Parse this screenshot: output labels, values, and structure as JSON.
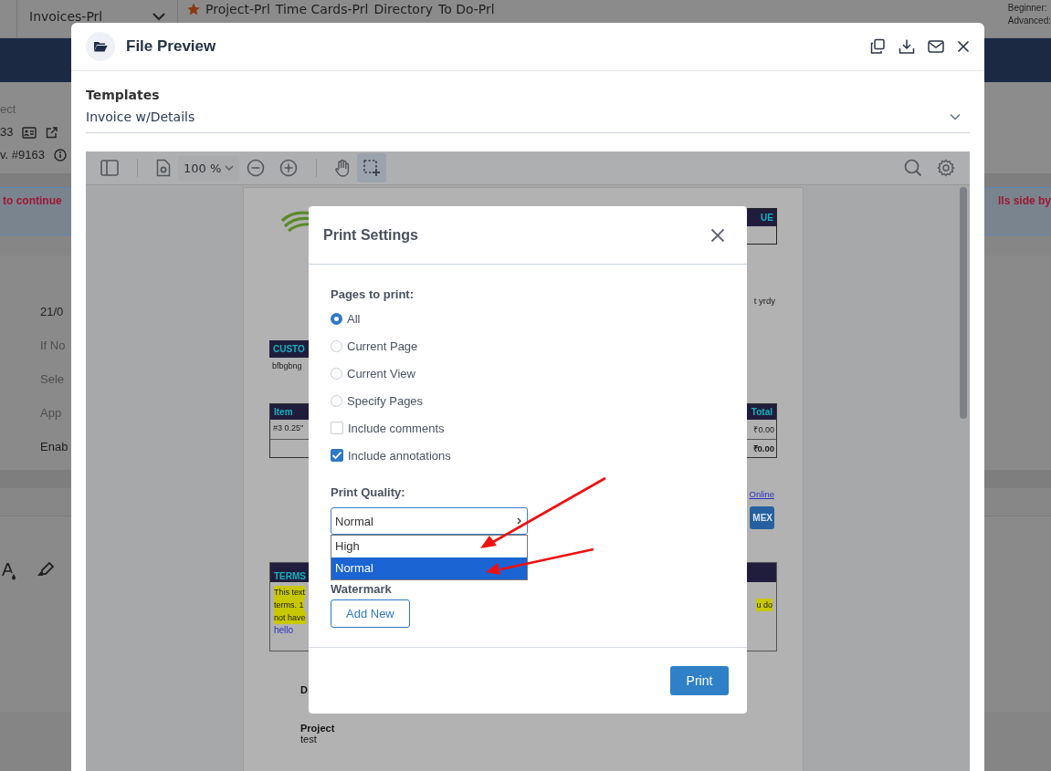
{
  "app_bar": {
    "menu_item": "Invoices-Prl",
    "favorites": [
      {
        "label": "Project-Prl",
        "starred": true
      },
      {
        "label": "Time Cards-Prl",
        "starred": false
      },
      {
        "label": "Directory",
        "starred": false
      },
      {
        "label": "To Do-Prl",
        "starred": false
      }
    ],
    "levels": [
      "Beginner:",
      "Advanced:"
    ]
  },
  "background": {
    "header_lines": [
      "ect",
      "33",
      "v. #9163"
    ],
    "banner_left": "to continue",
    "banner_right": "lls side by",
    "form_values": [
      {
        "text": "21/0",
        "muted": false
      },
      {
        "text": "If No",
        "muted": true
      },
      {
        "text": "Sele",
        "muted": true
      },
      {
        "text": "App",
        "muted": true
      },
      {
        "text": "Enab",
        "muted": false
      }
    ]
  },
  "file_preview": {
    "title": "File Preview",
    "templates_label": "Templates",
    "template_value": "Invoice w/Details"
  },
  "viewer": {
    "zoom": "100 %",
    "tools": [
      {
        "kind": "hand",
        "selected": false
      },
      {
        "kind": "select",
        "selected": true
      }
    ]
  },
  "document": {
    "header_cell": "UE",
    "address_tail": "t yrdy",
    "customer_header": "CUSTO",
    "customer_name": "bfbgbng",
    "items_header": [
      "Item",
      "Total"
    ],
    "item_row": [
      "#3 0.25\"",
      "₹0.00"
    ],
    "total": "₹0.00",
    "link": "Online",
    "card_badge": "MEX",
    "terms_header": "TERMS",
    "terms_left": [
      "This text",
      "terms. 1",
      "not have"
    ],
    "terms_right": "u do",
    "terms_link": "hello",
    "date_label": "D",
    "project_label": "Project",
    "project_value": "test"
  },
  "print_settings": {
    "title": "Print Settings",
    "pages_label": "Pages to print:",
    "page_options": [
      {
        "label": "All",
        "selected": true
      },
      {
        "label": "Current Page",
        "selected": false
      },
      {
        "label": "Current View",
        "selected": false
      },
      {
        "label": "Specify Pages",
        "selected": false
      }
    ],
    "options": [
      {
        "label": "Include comments",
        "checked": false
      },
      {
        "label": "Include annotations",
        "checked": true
      }
    ],
    "quality_label": "Print Quality:",
    "quality_value": "Normal",
    "quality_options": [
      {
        "label": "High",
        "selected": false
      },
      {
        "label": "Normal",
        "selected": true
      }
    ],
    "watermark_label": "Watermark",
    "add_button": "Add New",
    "print_button": "Print"
  }
}
